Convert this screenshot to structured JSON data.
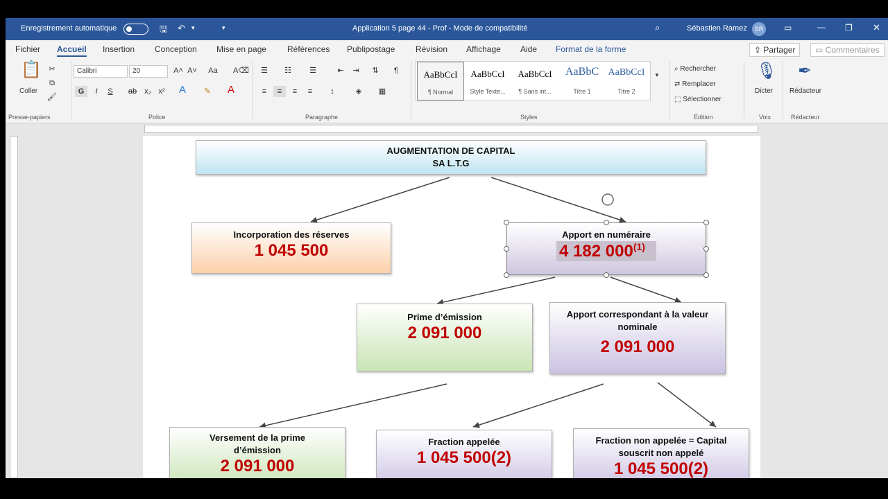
{
  "titlebar": {
    "autosave": "Enregistrement automatique",
    "doc_title": "Application 5 page 44 - Prof  -  Mode de compatibilité",
    "user": "Sébastien Ramez",
    "initials": "SR"
  },
  "tabs": [
    "Fichier",
    "Accueil",
    "Insertion",
    "Conception",
    "Mise en page",
    "Références",
    "Publipostage",
    "Révision",
    "Affichage",
    "Aide",
    "Format de la forme"
  ],
  "share": "Partager",
  "comments": "Commentaires",
  "ribbon": {
    "clipboard": {
      "paste": "Coller",
      "group": "Presse-papiers"
    },
    "font": {
      "name": "Calibri",
      "size": "20",
      "group": "Police"
    },
    "paragraph": {
      "group": "Paragraphe"
    },
    "styles": {
      "group": "Styles",
      "items": [
        {
          "preview": "AaBbCcI",
          "name": "¶ Normal"
        },
        {
          "preview": "AaBbCcI",
          "name": "Style Texte..."
        },
        {
          "preview": "AaBbCcI",
          "name": "¶ Sans int..."
        },
        {
          "preview": "AaBbC",
          "name": "Titre 1"
        },
        {
          "preview": "AaBbCcI",
          "name": "Titre 2"
        }
      ]
    },
    "editing": {
      "find": "Rechercher",
      "replace": "Remplacer",
      "select": "Sélectionner",
      "group": "Édition"
    },
    "voice": {
      "dictate": "Dicter",
      "group": "Voix"
    },
    "editor": {
      "label": "Rédacteur",
      "group": "Rédacteur"
    }
  },
  "diagram": {
    "title_line1": "AUGMENTATION DE CAPITAL",
    "title_line2": "SA L.T.G",
    "incorporation": {
      "label": "Incorporation des réserves",
      "value": "1 045 500"
    },
    "apport": {
      "label": "Apport en numéraire",
      "value": "4 182 000",
      "note": "(1)"
    },
    "prime": {
      "label": "Prime d’émission",
      "value": "2 091 000"
    },
    "nominale": {
      "label1": "Apport correspondant à la valeur",
      "label2": "nominale",
      "value": "2 091 000"
    },
    "versement": {
      "label1": "Versement de la prime",
      "label2": "d’émission",
      "value": "2 091 000"
    },
    "appelee": {
      "label": "Fraction appelée",
      "value": "1 045 500(2)"
    },
    "non_appelee": {
      "label1": "Fraction non appelée = Capital",
      "label2": "souscrit non appelé",
      "value": "1 045 500(2)"
    }
  }
}
